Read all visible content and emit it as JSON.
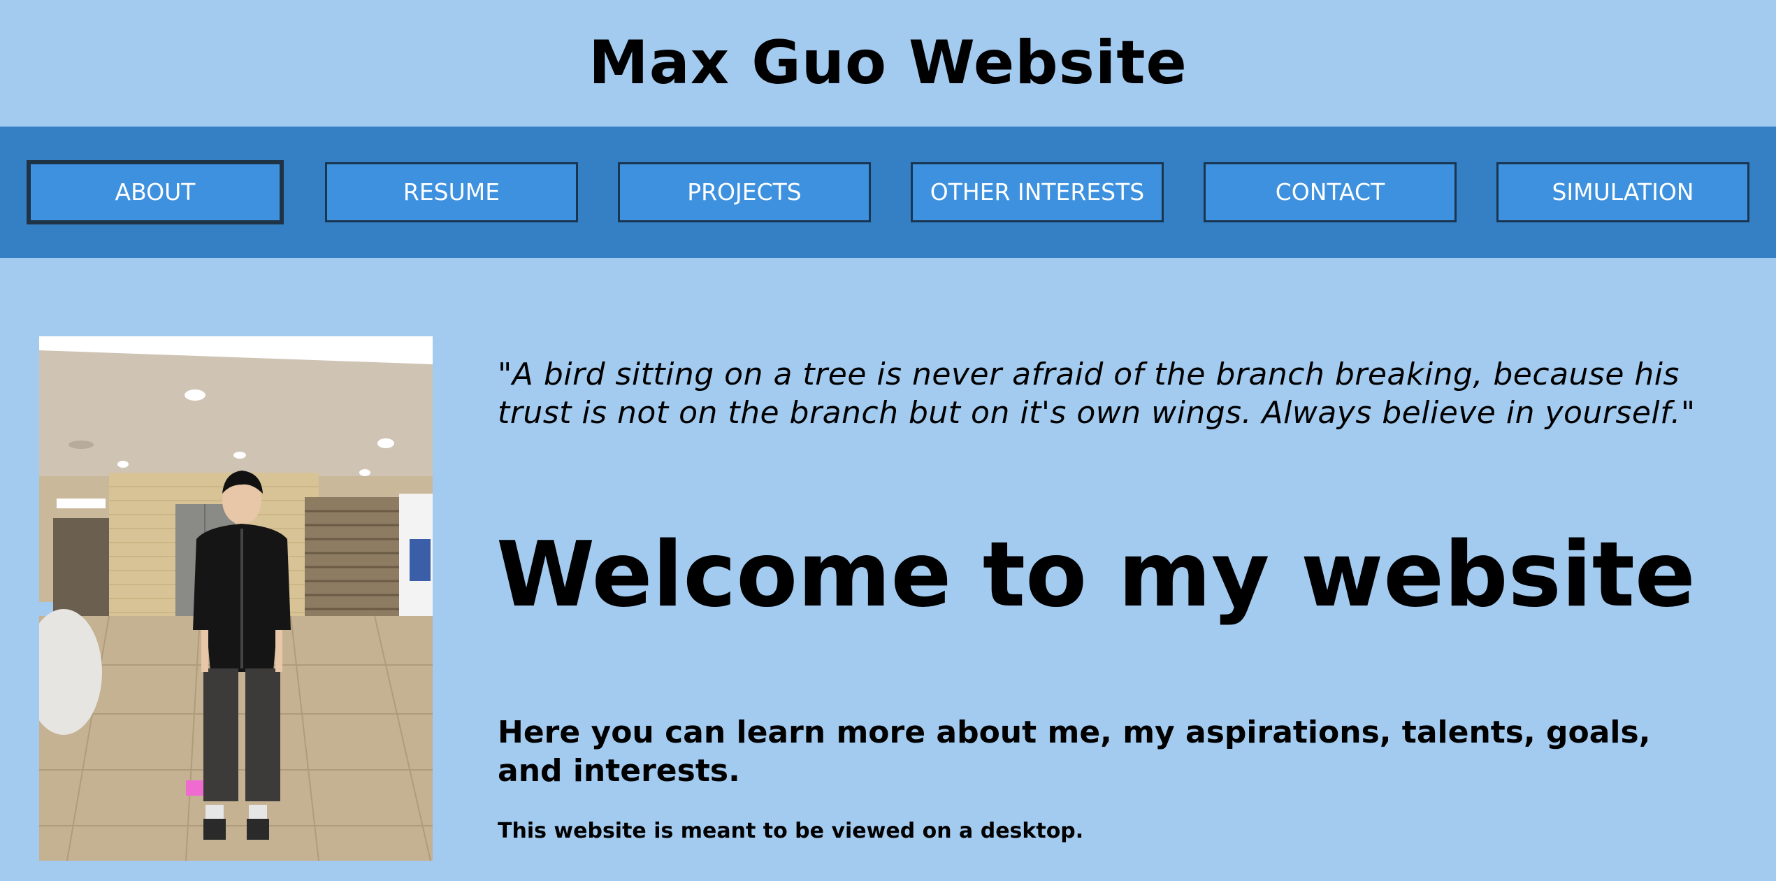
{
  "header": {
    "title": "Max Guo Website"
  },
  "nav": {
    "items": [
      {
        "label": "ABOUT",
        "active": true
      },
      {
        "label": "RESUME",
        "active": false
      },
      {
        "label": "PROJECTS",
        "active": false
      },
      {
        "label": "OTHER INTERESTS",
        "active": false
      },
      {
        "label": "CONTACT",
        "active": false
      },
      {
        "label": "SIMULATION",
        "active": false
      }
    ]
  },
  "main": {
    "quote": "\"A bird sitting on a tree is never afraid of the branch breaking, because his trust is not on the branch but on it's own wings. Always believe in yourself.\"",
    "welcome": "Welcome to my website",
    "intro": "Here you can learn more about me, my aspirations, talents, goals, and interests.",
    "note": "This website is meant to be viewed on a desktop."
  },
  "colors": {
    "page_bg": "#a3cbf0",
    "nav_bg": "#3580c5",
    "button_bg": "#3d91de",
    "button_border": "#1a3550"
  }
}
